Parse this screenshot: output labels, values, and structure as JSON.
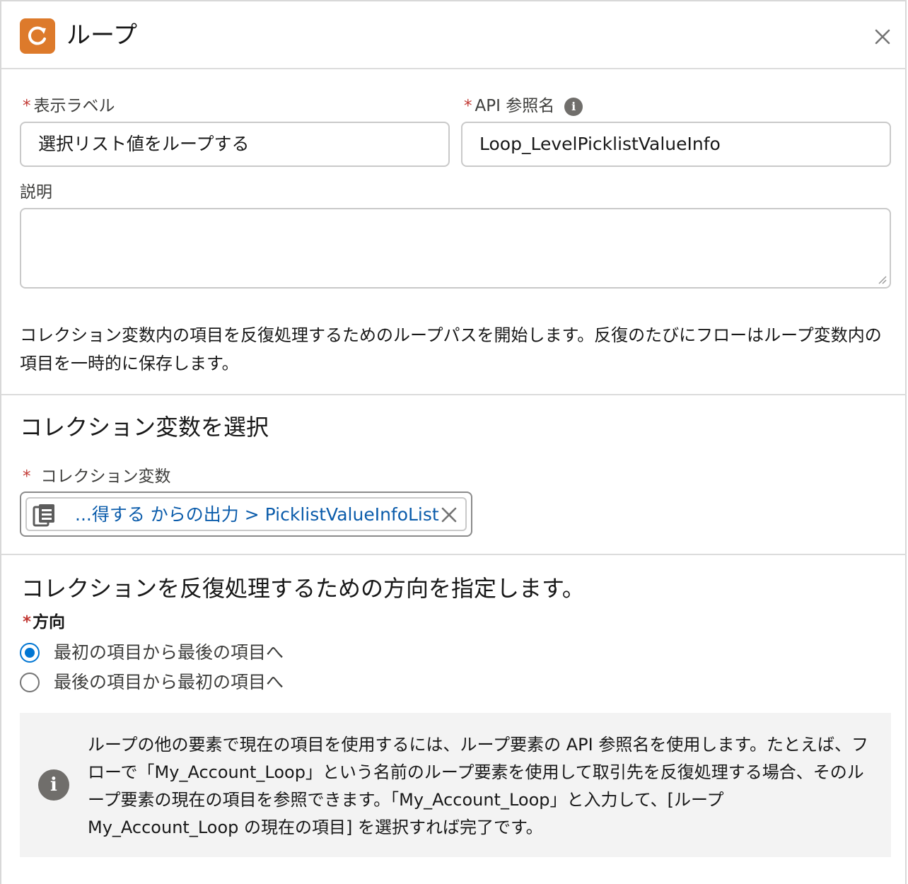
{
  "header": {
    "title": "ループ",
    "icon": "loop-icon",
    "close_icon": "close-icon",
    "accent": "#dd7a2b"
  },
  "fields": {
    "display_label": {
      "label": "表示ラベル",
      "required": "*",
      "value": "選択リスト値をループする"
    },
    "api_name": {
      "label": "API 参照名",
      "required": "*",
      "value": "Loop_LevelPicklistValueInfo",
      "info_icon": "i"
    },
    "description": {
      "label": "説明",
      "value": ""
    }
  },
  "intro_text": "コレクション変数内の項目を反復処理するためのループパスを開始します。反復のたびにフローはループ変数内の項目を一時的に保存します。",
  "collection_section": {
    "title": "コレクション変数を選択",
    "field_label": "コレクション変数",
    "required": "*",
    "pill_text": "...得する からの出力 > PicklistValueInfoList",
    "pill_icon": "collection-icon"
  },
  "direction_section": {
    "title": "コレクションを反復処理するための方向を指定します。",
    "field_label": "方向",
    "required": "*",
    "options": [
      {
        "label": "最初の項目から最後の項目へ",
        "checked": true
      },
      {
        "label": "最後の項目から最初の項目へ",
        "checked": false
      }
    ]
  },
  "info_box": {
    "icon": "i",
    "text": "ループの他の要素で現在の項目を使用するには、ループ要素の API 参照名を使用します。たとえば、フローで「My_Account_Loop」という名前のループ要素を使用して取引先を反復処理する場合、そのループ要素の現在の項目を参照できます。「My_Account_Loop」と入力して、[ループ My_Account_Loop の現在の項目] を選択すれば完了です。"
  }
}
